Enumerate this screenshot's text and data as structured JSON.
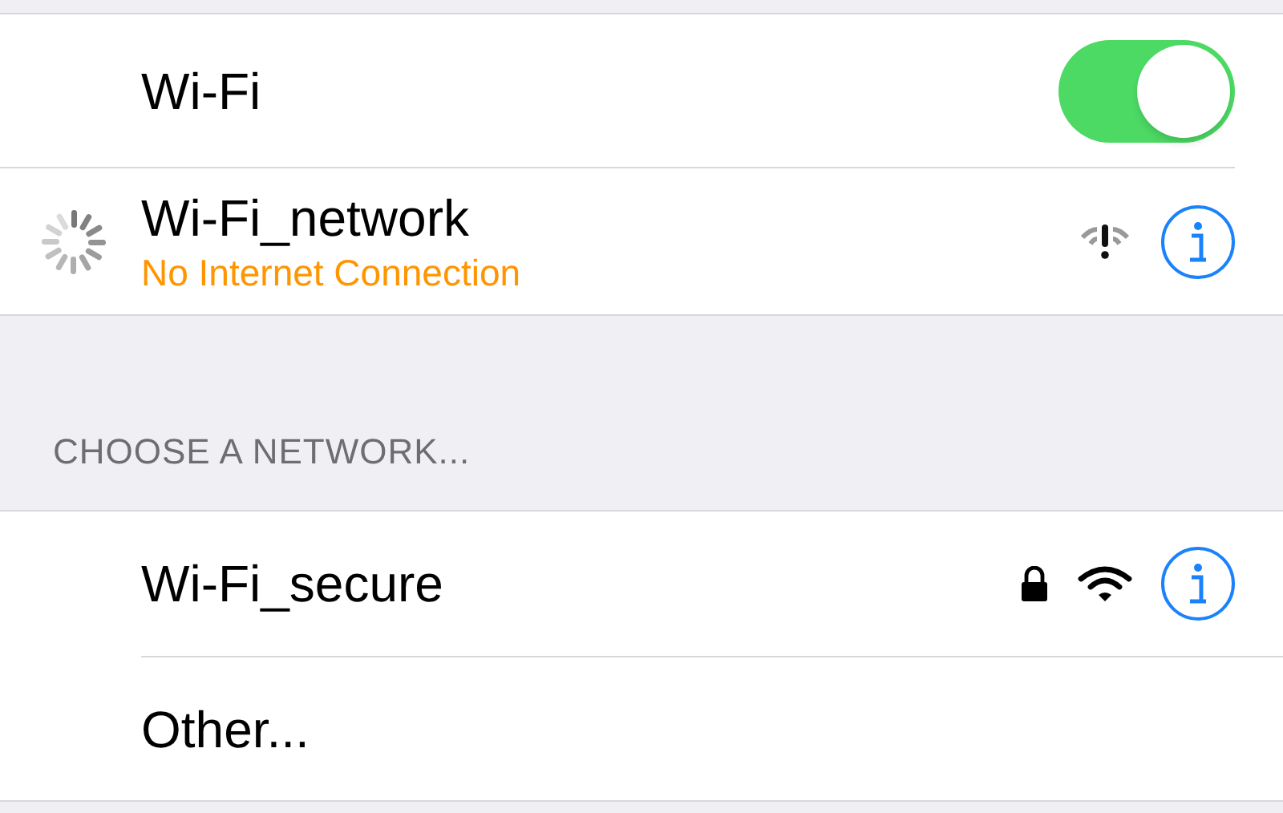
{
  "wifi": {
    "label": "Wi-Fi",
    "on": true
  },
  "current_network": {
    "name": "Wi-Fi_network",
    "status": "No Internet Connection",
    "connecting": true
  },
  "section_header": "CHOOSE A NETWORK...",
  "networks": [
    {
      "kind": "network",
      "name": "Wi-Fi_secure",
      "locked": true
    },
    {
      "kind": "other",
      "name": "Other..."
    }
  ]
}
